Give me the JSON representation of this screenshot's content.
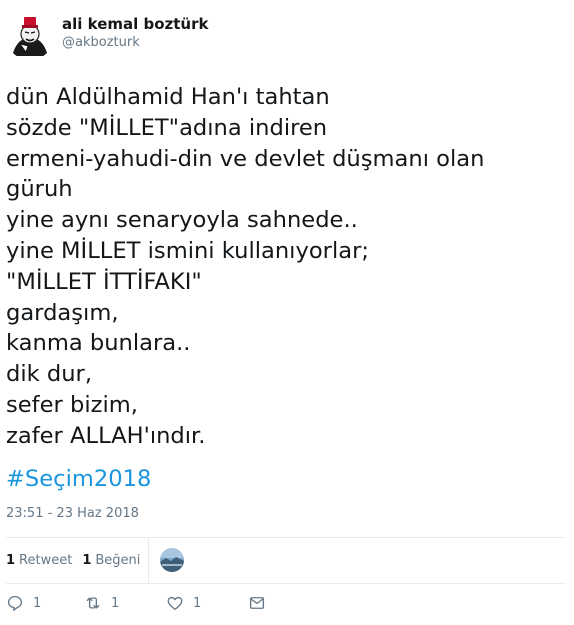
{
  "user": {
    "display_name": "ali kemal boztürk",
    "handle": "@akbozturk"
  },
  "tweet": {
    "text": "dün Aldülhamid Han'ı tahtan\nsözde \"MİLLET\"adına indiren\nermeni-yahudi-din ve devlet düşmanı olan\ngüruh\nyine aynı senaryoyla sahnede..\nyine MİLLET ismini kullanıyorlar;\n\"MİLLET İTTİFAKI\"\ngardaşım,\nkanma bunlara..\ndik dur,\nsefer bizim,\nzafer ALLAH'ındır.",
    "hashtag": "#Seçim2018",
    "timestamp": "23:51 - 23 Haz 2018"
  },
  "stats": {
    "retweets_count": "1",
    "retweets_label": "Retweet",
    "likes_count": "1",
    "likes_label": "Beğeni"
  },
  "actions": {
    "reply_count": "1",
    "retweet_count": "1",
    "like_count": "1"
  },
  "icons": [
    "reply-icon",
    "retweet-icon",
    "like-icon",
    "direct-message-icon"
  ],
  "colors": {
    "link": "#1b95e0",
    "muted": "#657786",
    "text": "#14171a"
  }
}
